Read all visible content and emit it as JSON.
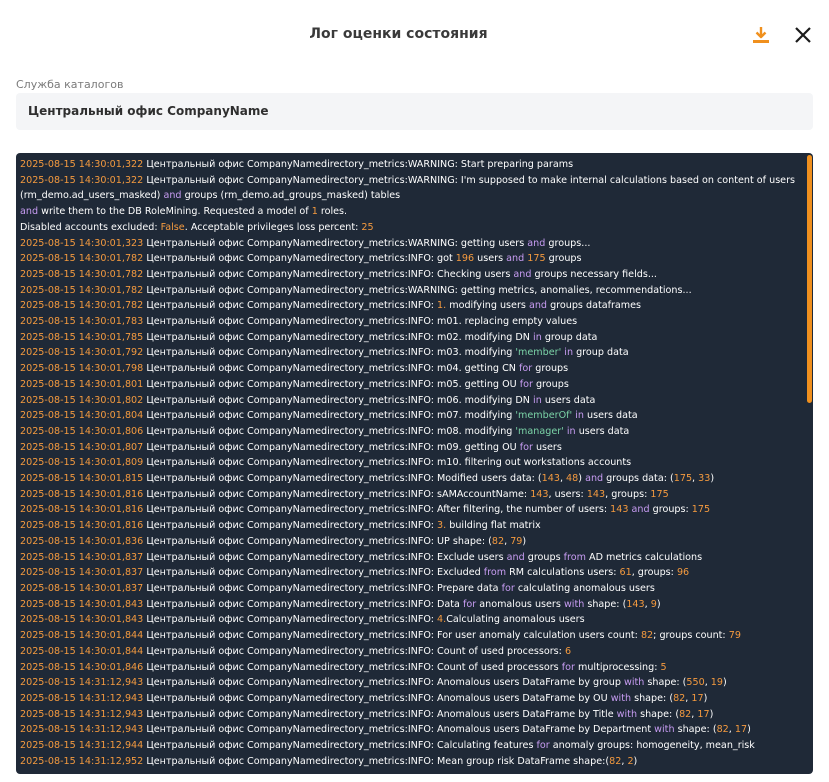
{
  "dialog": {
    "title": "Лог оценки состояния",
    "download_icon": "download-icon",
    "close_icon": "close-icon"
  },
  "field": {
    "label": "Служба каталогов",
    "value": "Центральный офис CompanyName"
  },
  "colors": {
    "accent": "#f0901e",
    "log_bg": "#1f2937",
    "timestamp": "#f49a3f",
    "keyword": "#c79cf2",
    "string": "#7bd3a7"
  },
  "log_lines": [
    [
      [
        "ts",
        "2025-08-15 14:30:01,322"
      ],
      [
        "t",
        " Центральный офис CompanyNamedirectory_metrics:WARNING: Start preparing params"
      ]
    ],
    [
      [
        "ts",
        "2025-08-15 14:30:01,322"
      ],
      [
        "t",
        " Центральный офис CompanyNamedirectory_metrics:WARNING: I'm supposed to make internal calculations based on content of users (rm_demo.ad_users_masked) "
      ],
      [
        "kw",
        "and"
      ],
      [
        "t",
        " groups (rm_demo.ad_groups_masked) tables"
      ]
    ],
    [
      [
        "kw",
        "and"
      ],
      [
        "t",
        " write them to the DB RoleMining. Requested a model of "
      ],
      [
        "num",
        "1"
      ],
      [
        "t",
        " roles."
      ]
    ],
    [
      [
        "t",
        "Disabled accounts excluded: "
      ],
      [
        "boo",
        "False"
      ],
      [
        "t",
        ". Acceptable privileges loss percent: "
      ],
      [
        "num",
        "25"
      ]
    ],
    [
      [
        "ts",
        "2025-08-15 14:30:01,323"
      ],
      [
        "t",
        " Центральный офис CompanyNamedirectory_metrics:WARNING: getting users "
      ],
      [
        "kw",
        "and"
      ],
      [
        "t",
        " groups..."
      ]
    ],
    [
      [
        "ts",
        "2025-08-15 14:30:01,782"
      ],
      [
        "t",
        " Центральный офис CompanyNamedirectory_metrics:INFO: got "
      ],
      [
        "num",
        "196"
      ],
      [
        "t",
        " users "
      ],
      [
        "kw",
        "and"
      ],
      [
        "t",
        " "
      ],
      [
        "num",
        "175"
      ],
      [
        "t",
        " groups"
      ]
    ],
    [
      [
        "ts",
        "2025-08-15 14:30:01,782"
      ],
      [
        "t",
        " Центральный офис CompanyNamedirectory_metrics:INFO: Checking users "
      ],
      [
        "kw",
        "and"
      ],
      [
        "t",
        " groups necessary fields..."
      ]
    ],
    [
      [
        "ts",
        "2025-08-15 14:30:01,782"
      ],
      [
        "t",
        " Центральный офис CompanyNamedirectory_metrics:WARNING: getting metrics, anomalies, recommendations..."
      ]
    ],
    [
      [
        "ts",
        "2025-08-15 14:30:01,782"
      ],
      [
        "t",
        " Центральный офис CompanyNamedirectory_metrics:INFO: "
      ],
      [
        "num",
        "1."
      ],
      [
        "t",
        " modifying users "
      ],
      [
        "kw",
        "and"
      ],
      [
        "t",
        " groups dataframes"
      ]
    ],
    [
      [
        "ts",
        "2025-08-15 14:30:01,783"
      ],
      [
        "t",
        " Центральный офис CompanyNamedirectory_metrics:INFO: m01. replacing empty values"
      ]
    ],
    [
      [
        "ts",
        "2025-08-15 14:30:01,785"
      ],
      [
        "t",
        " Центральный офис CompanyNamedirectory_metrics:INFO: m02. modifying DN "
      ],
      [
        "kw",
        "in"
      ],
      [
        "t",
        " group data"
      ]
    ],
    [
      [
        "ts",
        "2025-08-15 14:30:01,792"
      ],
      [
        "t",
        " Центральный офис CompanyNamedirectory_metrics:INFO: m03. modifying "
      ],
      [
        "str",
        "'member'"
      ],
      [
        "t",
        " "
      ],
      [
        "kw",
        "in"
      ],
      [
        "t",
        " group data"
      ]
    ],
    [
      [
        "ts",
        "2025-08-15 14:30:01,798"
      ],
      [
        "t",
        " Центральный офис CompanyNamedirectory_metrics:INFO: m04. getting CN "
      ],
      [
        "kw",
        "for"
      ],
      [
        "t",
        " groups"
      ]
    ],
    [
      [
        "ts",
        "2025-08-15 14:30:01,801"
      ],
      [
        "t",
        " Центральный офис CompanyNamedirectory_metrics:INFO: m05. getting OU "
      ],
      [
        "kw",
        "for"
      ],
      [
        "t",
        " groups"
      ]
    ],
    [
      [
        "ts",
        "2025-08-15 14:30:01,802"
      ],
      [
        "t",
        " Центральный офис CompanyNamedirectory_metrics:INFO: m06. modifying DN "
      ],
      [
        "kw",
        "in"
      ],
      [
        "t",
        " users data"
      ]
    ],
    [
      [
        "ts",
        "2025-08-15 14:30:01,804"
      ],
      [
        "t",
        " Центральный офис CompanyNamedirectory_metrics:INFO: m07. modifying "
      ],
      [
        "str",
        "'memberOf'"
      ],
      [
        "t",
        " "
      ],
      [
        "kw",
        "in"
      ],
      [
        "t",
        " users data"
      ]
    ],
    [
      [
        "ts",
        "2025-08-15 14:30:01,806"
      ],
      [
        "t",
        " Центральный офис CompanyNamedirectory_metrics:INFO: m08. modifying "
      ],
      [
        "str",
        "'manager'"
      ],
      [
        "t",
        " "
      ],
      [
        "kw",
        "in"
      ],
      [
        "t",
        " users data"
      ]
    ],
    [
      [
        "ts",
        "2025-08-15 14:30:01,807"
      ],
      [
        "t",
        " Центральный офис CompanyNamedirectory_metrics:INFO: m09. getting OU "
      ],
      [
        "kw",
        "for"
      ],
      [
        "t",
        " users"
      ]
    ],
    [
      [
        "ts",
        "2025-08-15 14:30:01,809"
      ],
      [
        "t",
        " Центральный офис CompanyNamedirectory_metrics:INFO: m10. filtering out workstations accounts"
      ]
    ],
    [
      [
        "ts",
        "2025-08-15 14:30:01,815"
      ],
      [
        "t",
        " Центральный офис CompanyNamedirectory_metrics:INFO: Modified users data: ("
      ],
      [
        "num",
        "143"
      ],
      [
        "t",
        ", "
      ],
      [
        "num",
        "48"
      ],
      [
        "t",
        ") "
      ],
      [
        "kw",
        "and"
      ],
      [
        "t",
        " groups data: ("
      ],
      [
        "num",
        "175"
      ],
      [
        "t",
        ", "
      ],
      [
        "num",
        "33"
      ],
      [
        "t",
        ")"
      ]
    ],
    [
      [
        "ts",
        "2025-08-15 14:30:01,816"
      ],
      [
        "t",
        " Центральный офис CompanyNamedirectory_metrics:INFO: sAMAccountName: "
      ],
      [
        "num",
        "143"
      ],
      [
        "t",
        ", users: "
      ],
      [
        "num",
        "143"
      ],
      [
        "t",
        ", groups: "
      ],
      [
        "num",
        "175"
      ]
    ],
    [
      [
        "ts",
        "2025-08-15 14:30:01,816"
      ],
      [
        "t",
        " Центральный офис CompanyNamedirectory_metrics:INFO: After filtering, the number of users: "
      ],
      [
        "num",
        "143"
      ],
      [
        "t",
        " "
      ],
      [
        "kw",
        "and"
      ],
      [
        "t",
        " groups: "
      ],
      [
        "num",
        "175"
      ]
    ],
    [
      [
        "ts",
        "2025-08-15 14:30:01,816"
      ],
      [
        "t",
        " Центральный офис CompanyNamedirectory_metrics:INFO: "
      ],
      [
        "num",
        "3."
      ],
      [
        "t",
        " building flat matrix"
      ]
    ],
    [
      [
        "ts",
        "2025-08-15 14:30:01,836"
      ],
      [
        "t",
        " Центральный офис CompanyNamedirectory_metrics:INFO: UP shape: ("
      ],
      [
        "num",
        "82"
      ],
      [
        "t",
        ", "
      ],
      [
        "num",
        "79"
      ],
      [
        "t",
        ")"
      ]
    ],
    [
      [
        "ts",
        "2025-08-15 14:30:01,837"
      ],
      [
        "t",
        " Центральный офис CompanyNamedirectory_metrics:INFO: Exclude users "
      ],
      [
        "kw",
        "and"
      ],
      [
        "t",
        " groups "
      ],
      [
        "kw",
        "from"
      ],
      [
        "t",
        " AD metrics calculations"
      ]
    ],
    [
      [
        "ts",
        "2025-08-15 14:30:01,837"
      ],
      [
        "t",
        " Центральный офис CompanyNamedirectory_metrics:INFO: Excluded "
      ],
      [
        "kw",
        "from"
      ],
      [
        "t",
        " RM calculations users: "
      ],
      [
        "num",
        "61"
      ],
      [
        "t",
        ", groups: "
      ],
      [
        "num",
        "96"
      ]
    ],
    [
      [
        "ts",
        "2025-08-15 14:30:01,837"
      ],
      [
        "t",
        " Центральный офис CompanyNamedirectory_metrics:INFO: Prepare data "
      ],
      [
        "kw",
        "for"
      ],
      [
        "t",
        " calculating anomalous users"
      ]
    ],
    [
      [
        "ts",
        "2025-08-15 14:30:01,843"
      ],
      [
        "t",
        " Центральный офис CompanyNamedirectory_metrics:INFO: Data "
      ],
      [
        "kw",
        "for"
      ],
      [
        "t",
        " anomalous users "
      ],
      [
        "kw",
        "with"
      ],
      [
        "t",
        " shape: ("
      ],
      [
        "num",
        "143"
      ],
      [
        "t",
        ", "
      ],
      [
        "num",
        "9"
      ],
      [
        "t",
        ")"
      ]
    ],
    [
      [
        "ts",
        "2025-08-15 14:30:01,843"
      ],
      [
        "t",
        " Центральный офис CompanyNamedirectory_metrics:INFO: "
      ],
      [
        "num",
        "4."
      ],
      [
        "t",
        "Calculating anomalous users"
      ]
    ],
    [
      [
        "ts",
        "2025-08-15 14:30:01,844"
      ],
      [
        "t",
        " Центральный офис CompanyNamedirectory_metrics:INFO: For user anomaly calculation users count: "
      ],
      [
        "num",
        "82"
      ],
      [
        "t",
        "; groups count: "
      ],
      [
        "num",
        "79"
      ]
    ],
    [
      [
        "ts",
        "2025-08-15 14:30:01,844"
      ],
      [
        "t",
        " Центральный офис CompanyNamedirectory_metrics:INFO: Count of used processors: "
      ],
      [
        "num",
        "6"
      ]
    ],
    [
      [
        "ts",
        "2025-08-15 14:30:01,846"
      ],
      [
        "t",
        " Центральный офис CompanyNamedirectory_metrics:INFO: Count of used processors "
      ],
      [
        "kw",
        "for"
      ],
      [
        "t",
        " multiprocessing: "
      ],
      [
        "num",
        "5"
      ]
    ],
    [
      [
        "ts",
        "2025-08-15 14:31:12,943"
      ],
      [
        "t",
        " Центральный офис CompanyNamedirectory_metrics:INFO: Anomalous users DataFrame by group "
      ],
      [
        "kw",
        "with"
      ],
      [
        "t",
        " shape: ("
      ],
      [
        "num",
        "550"
      ],
      [
        "t",
        ", "
      ],
      [
        "num",
        "19"
      ],
      [
        "t",
        ")"
      ]
    ],
    [
      [
        "ts",
        "2025-08-15 14:31:12,943"
      ],
      [
        "t",
        " Центральный офис CompanyNamedirectory_metrics:INFO: Anomalous users DataFrame by OU "
      ],
      [
        "kw",
        "with"
      ],
      [
        "t",
        " shape: ("
      ],
      [
        "num",
        "82"
      ],
      [
        "t",
        ", "
      ],
      [
        "num",
        "17"
      ],
      [
        "t",
        ")"
      ]
    ],
    [
      [
        "ts",
        "2025-08-15 14:31:12,943"
      ],
      [
        "t",
        " Центральный офис CompanyNamedirectory_metrics:INFO: Anomalous users DataFrame by Title "
      ],
      [
        "kw",
        "with"
      ],
      [
        "t",
        " shape: ("
      ],
      [
        "num",
        "82"
      ],
      [
        "t",
        ", "
      ],
      [
        "num",
        "17"
      ],
      [
        "t",
        ")"
      ]
    ],
    [
      [
        "ts",
        "2025-08-15 14:31:12,943"
      ],
      [
        "t",
        " Центральный офис CompanyNamedirectory_metrics:INFO: Anomalous users DataFrame by Department "
      ],
      [
        "kw",
        "with"
      ],
      [
        "t",
        " shape: ("
      ],
      [
        "num",
        "82"
      ],
      [
        "t",
        ", "
      ],
      [
        "num",
        "17"
      ],
      [
        "t",
        ")"
      ]
    ],
    [
      [
        "ts",
        "2025-08-15 14:31:12,944"
      ],
      [
        "t",
        " Центральный офис CompanyNamedirectory_metrics:INFO: Calculating features "
      ],
      [
        "kw",
        "for"
      ],
      [
        "t",
        " anomaly groups: homogeneity, mean_risk"
      ]
    ],
    [
      [
        "ts",
        "2025-08-15 14:31:12,952"
      ],
      [
        "t",
        " Центральный офис CompanyNamedirectory_metrics:INFO: Mean group risk DataFrame shape:("
      ],
      [
        "num",
        "82"
      ],
      [
        "t",
        ", "
      ],
      [
        "num",
        "2"
      ],
      [
        "t",
        ")"
      ]
    ]
  ]
}
